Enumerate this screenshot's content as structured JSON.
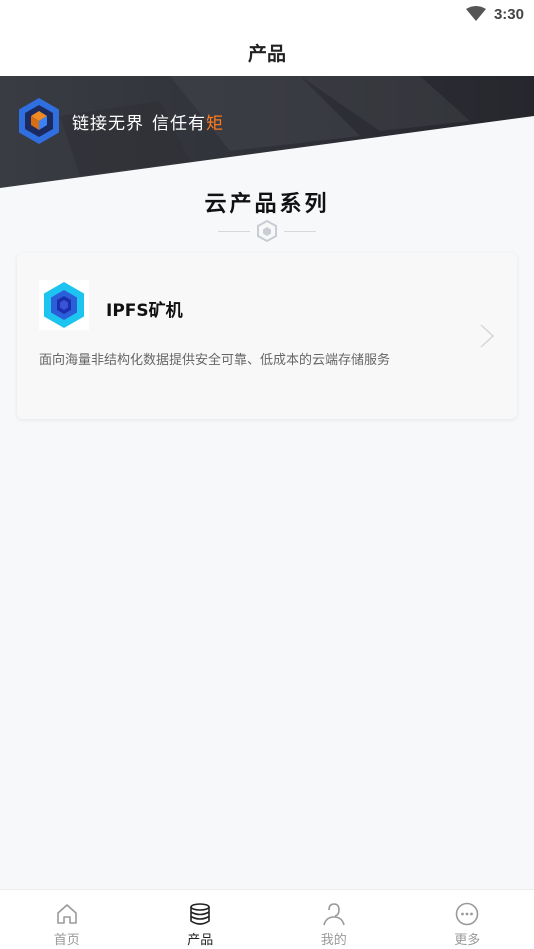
{
  "status_bar": {
    "time": "3:30",
    "wifi_icon": "wifi-icon"
  },
  "header": {
    "title": "产品"
  },
  "banner": {
    "slogan_part1": "链接无界",
    "slogan_part2": "信任有",
    "slogan_accent": "矩",
    "accent_color": "#ff7a1a",
    "logo_icon": "brand-cube-logo"
  },
  "section": {
    "title": "云产品系列",
    "divider_icon": "hexagon-icon"
  },
  "products": [
    {
      "name": "IPFS矿机",
      "description": "面向海量非结构化数据提供安全可靠、低成本的云端存储服务",
      "icon": "hexagon-cube-icon"
    }
  ],
  "tab_bar": {
    "tabs": [
      {
        "label": "首页",
        "icon": "home-icon",
        "active": false
      },
      {
        "label": "产品",
        "icon": "database-icon",
        "active": true
      },
      {
        "label": "我的",
        "icon": "user-icon",
        "active": false
      },
      {
        "label": "更多",
        "icon": "more-icon",
        "active": false
      }
    ]
  }
}
